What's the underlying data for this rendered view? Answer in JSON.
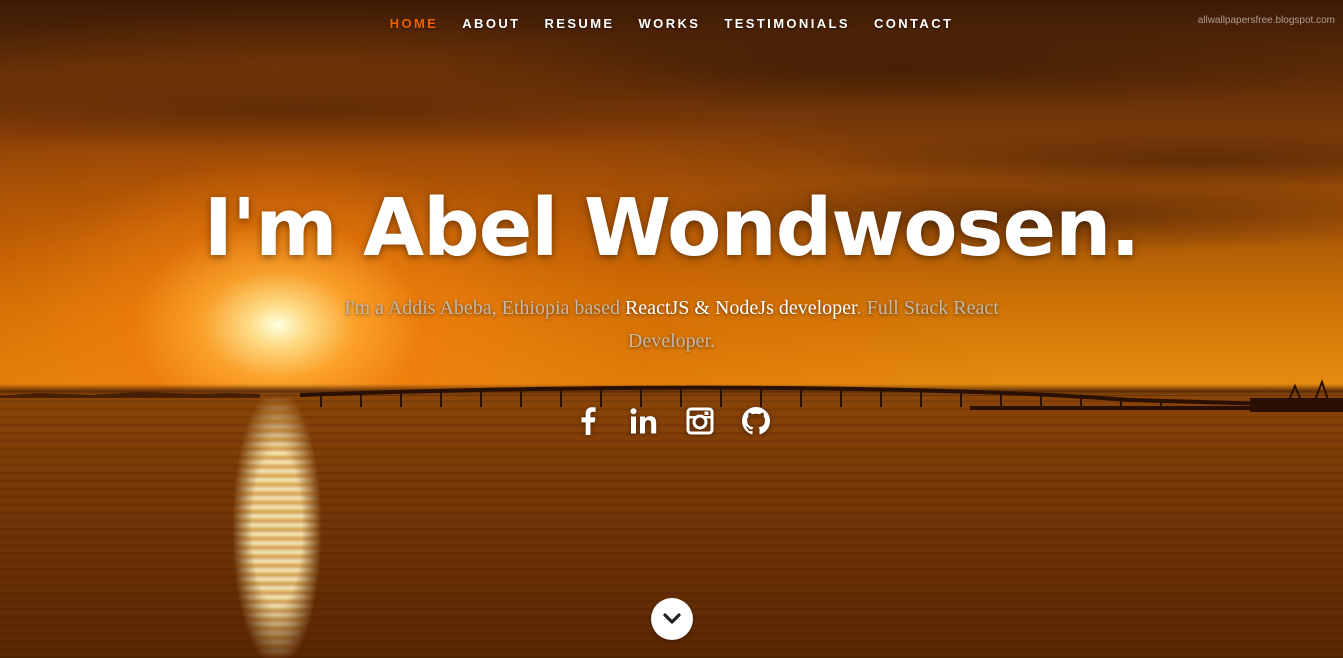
{
  "nav": {
    "items": [
      {
        "label": "HOME",
        "active": true
      },
      {
        "label": "ABOUT",
        "active": false
      },
      {
        "label": "RESUME",
        "active": false
      },
      {
        "label": "WORKS",
        "active": false
      },
      {
        "label": "TESTIMONIALS",
        "active": false
      },
      {
        "label": "CONTACT",
        "active": false
      }
    ],
    "active_color": "#f06000"
  },
  "credit": "allwallpapersfree.blogspot.com",
  "banner": {
    "headline": "I'm Abel Wondwosen.",
    "tagline_pre": "I'm a Addis Abeba, Ethiopia based ",
    "tagline_highlight": "ReactJS & NodeJs developer",
    "tagline_post": ". Full Stack React Developer."
  },
  "social": [
    {
      "icon": "facebook-icon"
    },
    {
      "icon": "linkedin-icon"
    },
    {
      "icon": "instagram-icon"
    },
    {
      "icon": "github-icon"
    }
  ],
  "scroll": {
    "icon": "chevron-down-icon"
  }
}
